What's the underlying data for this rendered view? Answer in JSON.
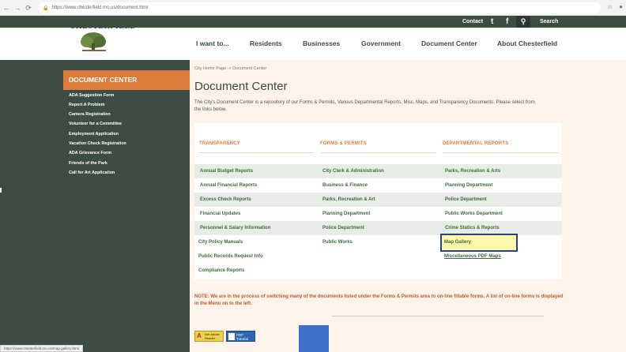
{
  "browser": {
    "url": "https://www.chesterfield.mo.us/document.html",
    "back": "←",
    "forward": "→",
    "reload": "⟳",
    "lock": "🔒",
    "star": "☆",
    "profile": "●"
  },
  "utility": {
    "contact": "Contact",
    "twitter": "t",
    "facebook": "f",
    "search_icon": "⚲",
    "search": "Search"
  },
  "header": {
    "logo_text": "CHESTERFIELD",
    "nav": [
      "I want to...",
      "Residents",
      "Businesses",
      "Government",
      "Document Center",
      "About Chesterfield"
    ]
  },
  "sidebar": {
    "title": "DOCUMENT CENTER",
    "items": [
      "ADA Suggestion Form",
      "Report A Problem",
      "Camera Registration",
      "Volunteer for a Committee",
      "Employment Application",
      "Vacation Check Registration",
      "ADA Grievance Form",
      "Friends of the Park",
      "Call for Art Application"
    ]
  },
  "main": {
    "breadcrumb": "City Home Page -> Document Center",
    "title": "Document Center",
    "intro": "The City's Document Center is a repository of our Forms & Permits, Various Departmental Reports, Misc. Maps, and Transparency Documents. Please select from the links below.",
    "columns": {
      "transparency": {
        "header": "TRANSPARENCY",
        "links": [
          "Annual Budget Reports",
          "Annual Financial Reports",
          "Excess Check Reports",
          "Financial Updates",
          "Personnel & Salary Information",
          "City Policy Manuals",
          "Public Records Request Info",
          "Compliance Reports"
        ]
      },
      "forms": {
        "header": "FORMS & PERMITS",
        "links": [
          "City Clerk & Administration",
          "Business & Finance",
          "Parks, Recreation & Art",
          "Planning Department",
          "Police Department",
          "Public Works"
        ]
      },
      "departmental": {
        "header": "DEPARTMENTAL REPORTS",
        "links": [
          "Parks, Recreation & Arts",
          "Planning Department",
          "Police Department",
          "Public Works Department",
          "Crime Statics & Reports",
          "Map Gallery",
          "Miscellaneous PDF Maps"
        ]
      }
    },
    "note": "NOTE: We are in the process of switching many of the documents listed under the Forms & Permits area to on-line fillable forms. A list of on-line forms is displayed in the Menu on to the left.",
    "badge_adobe_a": "A",
    "badge_adobe_text": "Get Adobe Reader",
    "badge_pdf_text": "PDF Tutorial"
  },
  "status_bar": "https://www.chesterfield.mo.us/map-gallery.html",
  "colors": {
    "dark_green": "#3e4d43",
    "accent_orange": "#dd7b3a",
    "link_green": "#3f6b3c",
    "highlight_yellow": "#fff8a8",
    "highlight_border": "#2c3e86"
  }
}
